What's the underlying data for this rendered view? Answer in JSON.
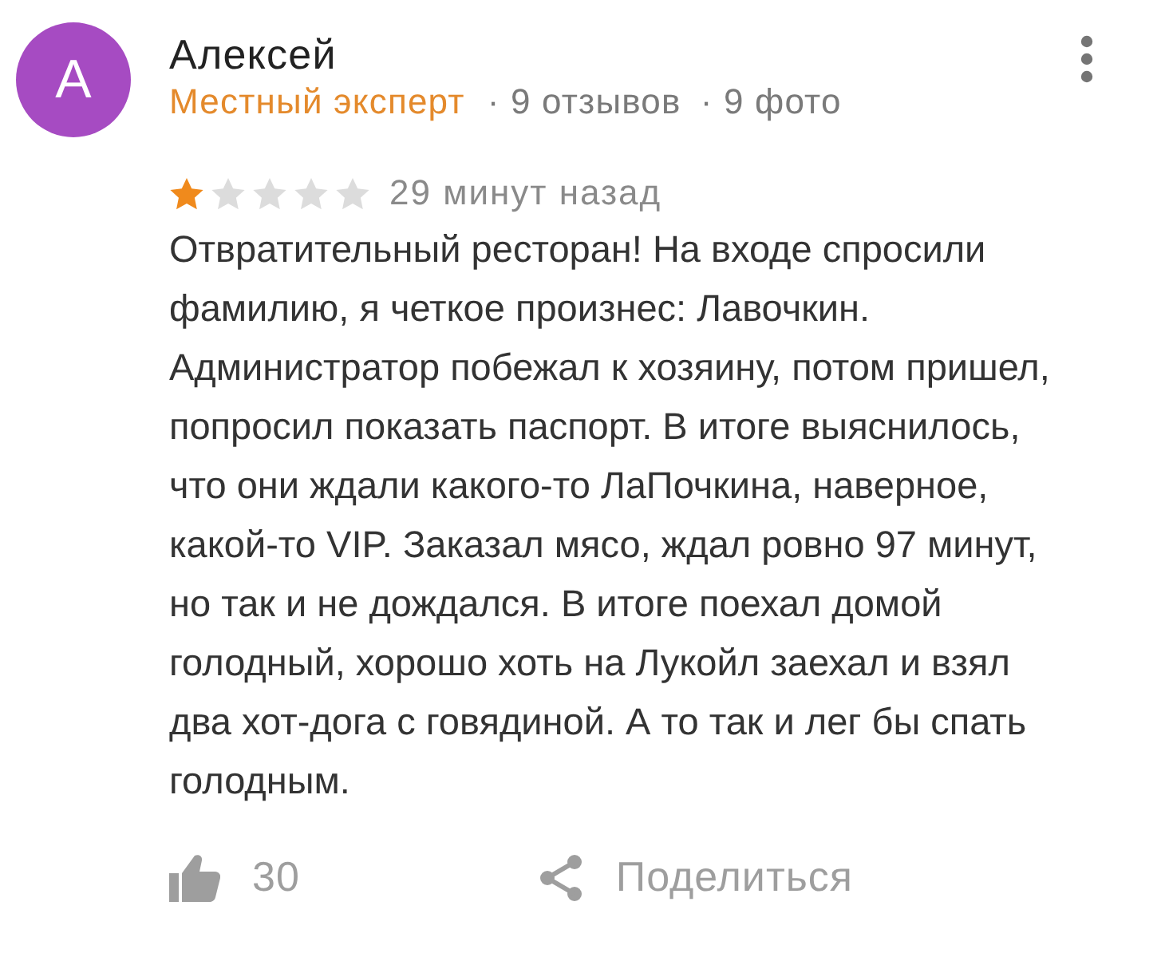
{
  "review": {
    "avatar": {
      "initial": "А",
      "color": "#a64bc2"
    },
    "author": "Алексей",
    "badge": "Местный эксперт",
    "meta": [
      "· 9 отзывов",
      "· 9 фото"
    ],
    "stars": 1,
    "time": "29 минут назад",
    "text": "Отвратительный ресторан! На входе спросили фамилию, я четкое произнес: Лавочкин. Администратор побежал к хозяину, потом пришел, попросил показать паспорт. В итоге выяснилось, что они ждали какого-то ЛаПочкина, наверное, какой-то VIP. Заказал мясо, ждал ровно 97 минут, но так и не дождался. В итоге поехал домой голодный, хорошо хоть на Лукойл заехал и взял два хот-дога с говядиной. А то так и лег бы спать голодным.",
    "likes": "30",
    "share": "Поделиться"
  }
}
